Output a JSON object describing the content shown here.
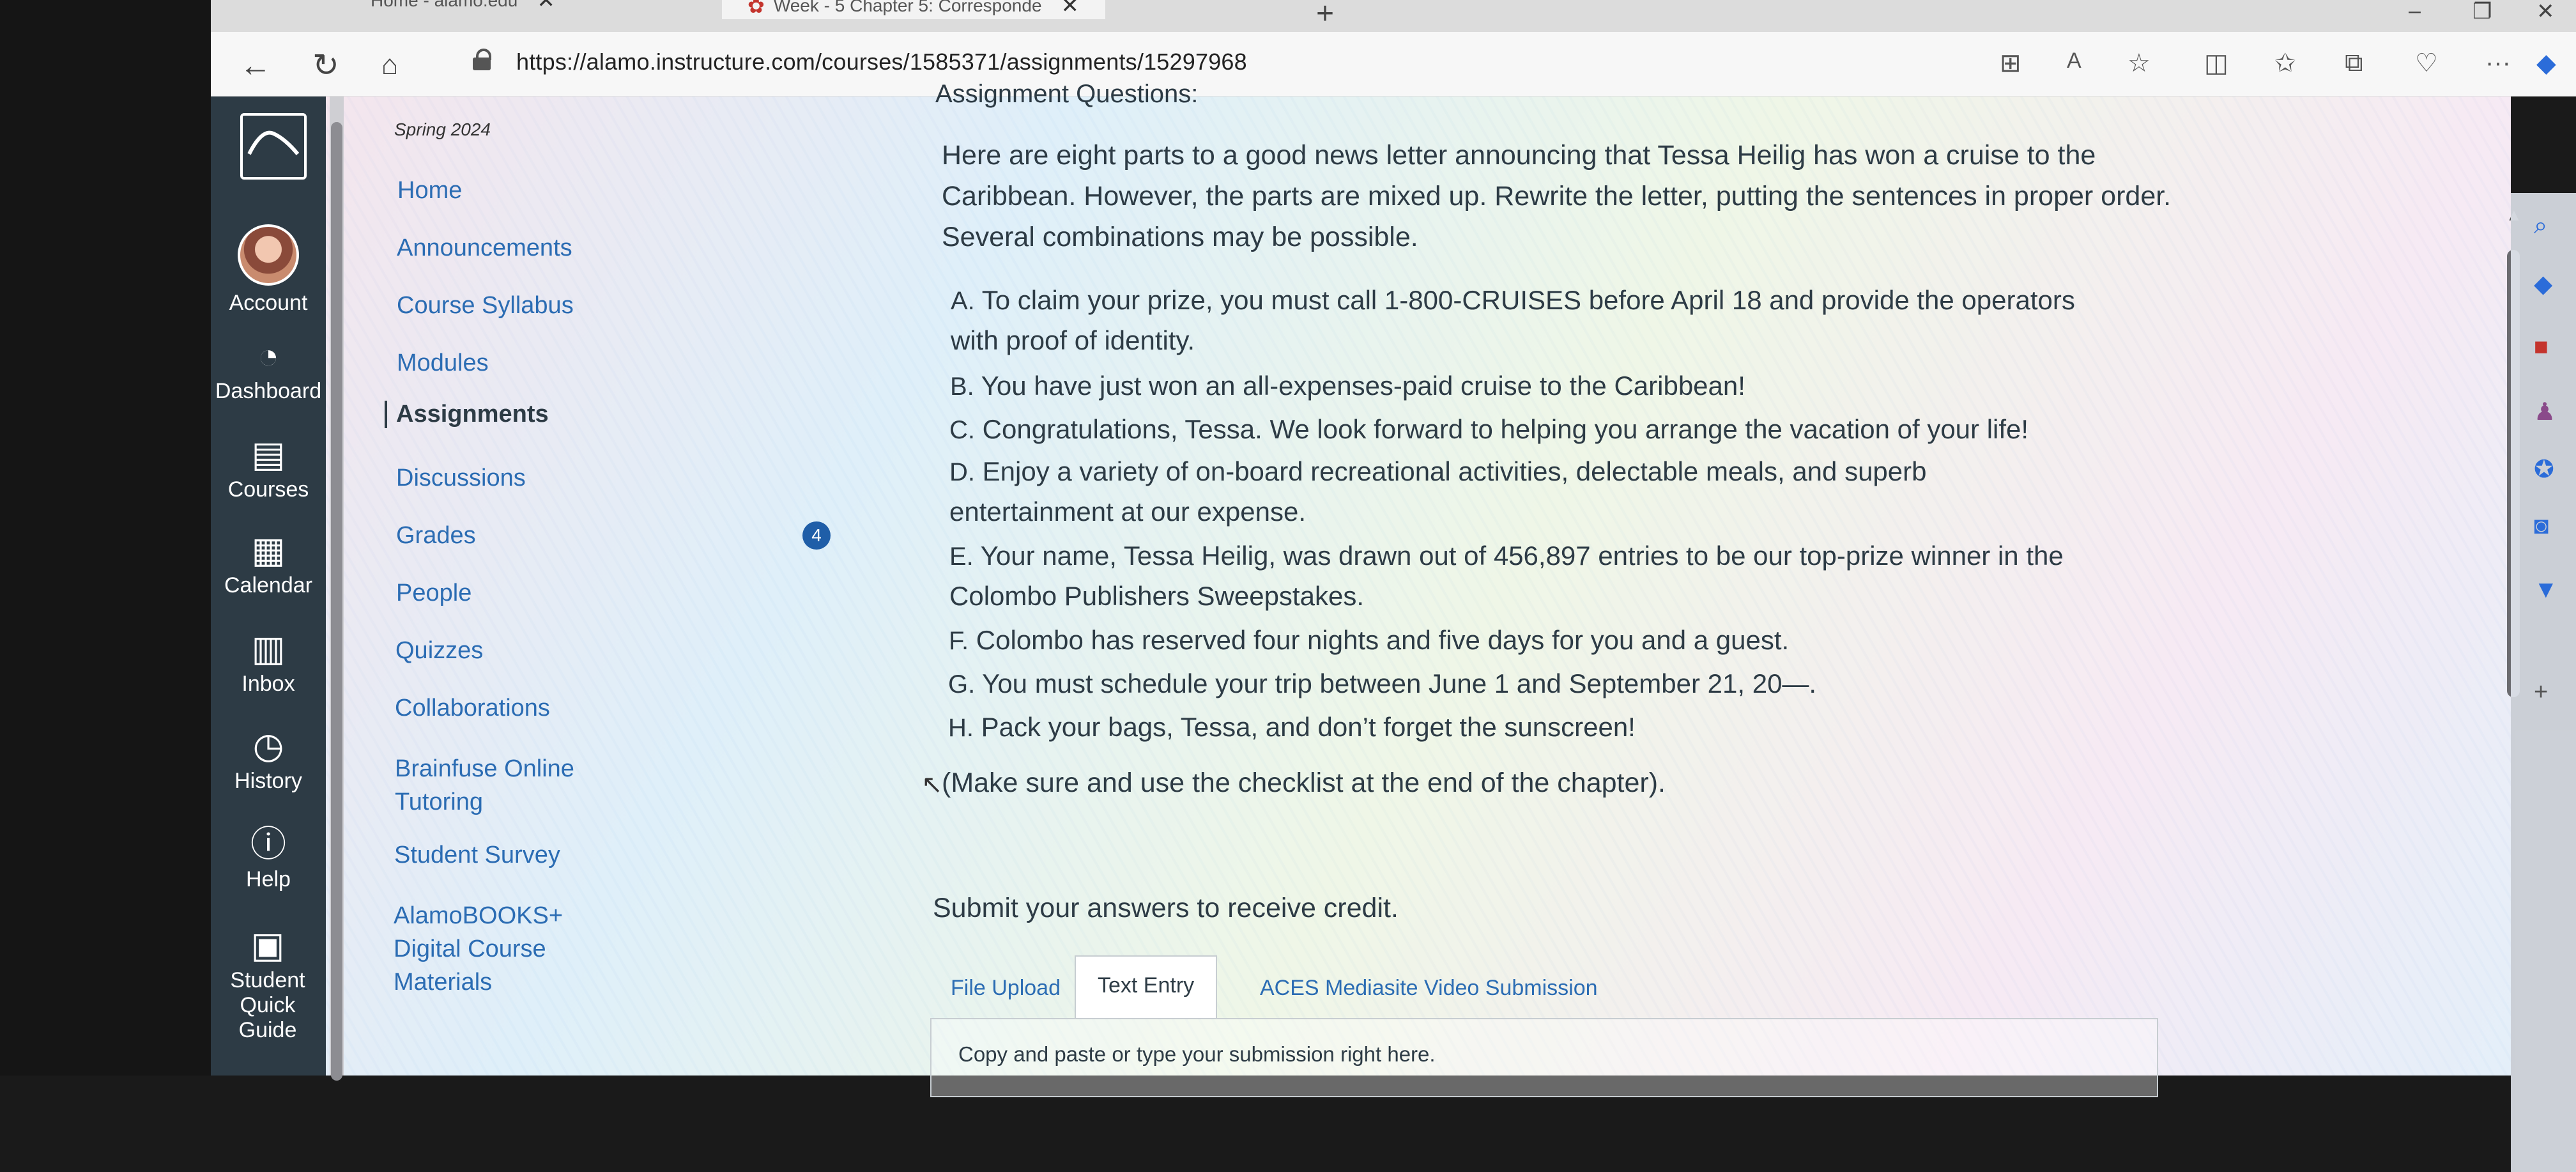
{
  "browser": {
    "tabs": [
      {
        "label": "Home - alamo.edu"
      },
      {
        "label": "Week - 5 Chapter 5: Corresponde",
        "active": true
      }
    ],
    "url": "https://alamo.instructure.com/courses/1585371/assignments/15297968"
  },
  "global_nav": {
    "items": [
      {
        "label": "Account"
      },
      {
        "label": "Dashboard"
      },
      {
        "label": "Courses"
      },
      {
        "label": "Calendar"
      },
      {
        "label": "Inbox"
      },
      {
        "label": "History"
      },
      {
        "label": "Help"
      },
      {
        "label": "Student Quick Guide"
      }
    ]
  },
  "course_nav": {
    "term": "Spring 2024",
    "items": [
      {
        "label": "Home"
      },
      {
        "label": "Announcements"
      },
      {
        "label": "Course Syllabus"
      },
      {
        "label": "Modules"
      },
      {
        "label": "Assignments",
        "active": true
      },
      {
        "label": "Discussions"
      },
      {
        "label": "Grades",
        "badge": "4"
      },
      {
        "label": "People"
      },
      {
        "label": "Quizzes"
      },
      {
        "label": "Collaborations"
      },
      {
        "label": "Brainfuse Online Tutoring"
      },
      {
        "label": "Student Survey"
      },
      {
        "label": "AlamoBOOKS+ Digital Course Materials"
      }
    ]
  },
  "assignment": {
    "heading": "Assignment Questions:",
    "intro": "Here are eight parts to a good news letter announcing that Tessa Heilig has won a cruise to the Caribbean. However, the parts are mixed up. Rewrite the letter, putting the sentences in proper order. Several combinations may be possible.",
    "items": [
      {
        "letter": "A.",
        "text": "To claim your prize, you must call 1-800-CRUISES before April 18 and provide the operators with proof of identity."
      },
      {
        "letter": "B.",
        "text": "You have just won an all-expenses-paid cruise to the Caribbean!"
      },
      {
        "letter": "C.",
        "text": "Congratulations, Tessa. We look forward to helping you arrange the vacation of your life!"
      },
      {
        "letter": "D.",
        "text": "Enjoy a variety of on-board recreational activities, delectable meals, and superb entertainment at our expense."
      },
      {
        "letter": "E.",
        "text": "Your name, Tessa Heilig, was drawn out of 456,897 entries to be our top-prize winner in the Colombo Publishers Sweepstakes."
      },
      {
        "letter": "F.",
        "text": "Colombo has reserved four nights and five days for you and a guest."
      },
      {
        "letter": "G.",
        "text": "You must schedule your trip between June 1 and September 21, 20—."
      },
      {
        "letter": "H.",
        "text": "Pack your bags, Tessa, and don’t forget the sunscreen!"
      }
    ],
    "note": "(Make sure and use the checklist at the end of the chapter).",
    "submit_prompt": "Submit your answers to receive credit.",
    "submission_tabs": [
      {
        "label": "File Upload"
      },
      {
        "label": "Text Entry",
        "active": true
      },
      {
        "label": "ACES Mediasite Video Submission"
      }
    ],
    "entry_placeholder": "Copy and paste or type your submission right here."
  },
  "colors": {
    "canvas_nav": "#2d3b45",
    "link": "#2b6cb3",
    "badge": "#1f5ea8"
  }
}
